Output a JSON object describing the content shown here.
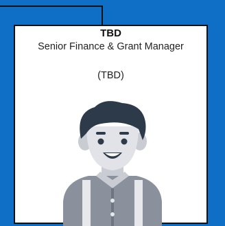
{
  "node": {
    "name": "TBD",
    "title": "Senior Finance & Grant Manager",
    "subtitle": "(TBD)",
    "avatar_icon": "person-avatar-icon"
  },
  "colors": {
    "background": "#0f6fc6",
    "card": "#ffffff",
    "border": "#111111"
  }
}
